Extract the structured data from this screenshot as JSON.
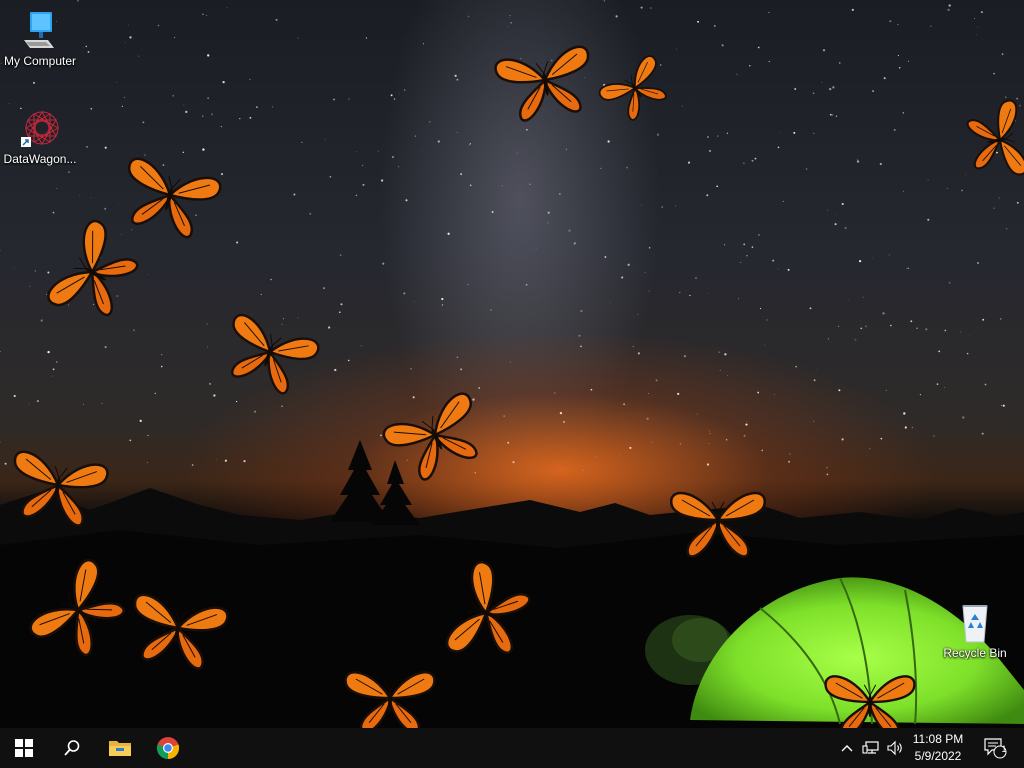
{
  "desktop": {
    "wallpaper": "night sky with milky way, tent and butterflies",
    "icons": [
      {
        "label": "My Computer",
        "icon": "computer-icon"
      },
      {
        "label": "DataWagon...",
        "icon": "datawagon-shortcut-icon"
      },
      {
        "label": "Recycle Bin",
        "icon": "recycle-bin-icon"
      }
    ]
  },
  "taskbar": {
    "buttons": [
      {
        "name": "start",
        "icon": "windows-start-icon"
      },
      {
        "name": "search",
        "icon": "search-icon"
      },
      {
        "name": "file-explorer",
        "icon": "folder-icon"
      },
      {
        "name": "chrome",
        "icon": "chrome-icon"
      }
    ],
    "tray": {
      "chevron_icon": "chevron-up-icon",
      "network_icon": "network-icon",
      "volume_icon": "volume-icon",
      "time": "11:08 PM",
      "date": "5/9/2022",
      "notification_count": "1"
    }
  },
  "colors": {
    "taskbar": "#101010",
    "butterfly_orange": "#f07a12",
    "tent_green": "#7ee02a"
  }
}
